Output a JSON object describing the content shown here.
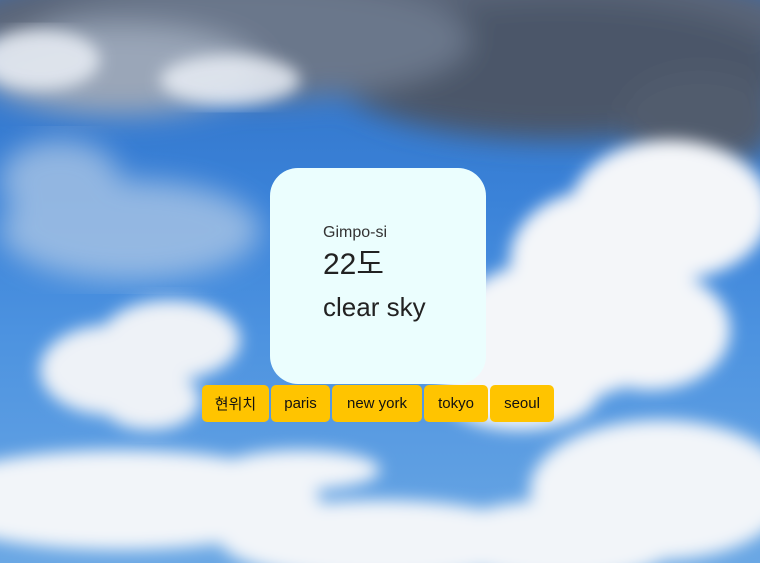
{
  "weather": {
    "city": "Gimpo-si",
    "temperature": "22도",
    "description": "clear sky"
  },
  "buttons": [
    {
      "label": "현위치"
    },
    {
      "label": "paris"
    },
    {
      "label": "new york"
    },
    {
      "label": "tokyo"
    },
    {
      "label": "seoul"
    }
  ],
  "colors": {
    "card_background": "#ebfefe",
    "button_background": "#ffc400",
    "sky_blue": "#3a82d8"
  }
}
